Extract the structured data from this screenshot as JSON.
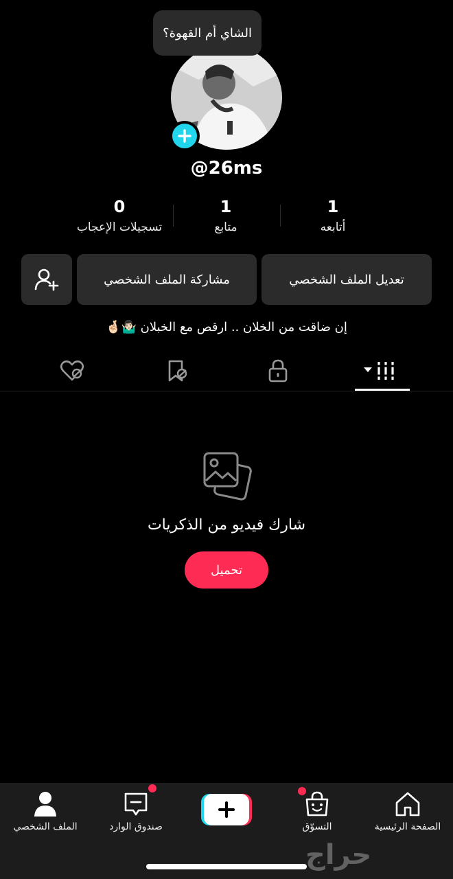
{
  "profile": {
    "bubble_text": "الشاي أم القهوة؟",
    "handle": "@26ms"
  },
  "stats": [
    {
      "value": "0",
      "label": "تسجيلات الإعجاب"
    },
    {
      "value": "1",
      "label": "متابع"
    },
    {
      "value": "1",
      "label": "أتابعه"
    }
  ],
  "actions": {
    "edit_label": "تعديل الملف الشخصي",
    "share_label": "مشاركة الملف الشخصي",
    "add_friend_icon": "add-user-icon"
  },
  "bio": "إن ضاقت من الخلان .. ارقص مع الخبلان 🤷🏻‍♂️🤞🏻",
  "tabs": [
    {
      "icon": "liked-heart-hidden-icon"
    },
    {
      "icon": "bookmark-hidden-icon"
    },
    {
      "icon": "lock-icon"
    },
    {
      "icon": "grid-videos-icon",
      "active": true
    }
  ],
  "empty_state": {
    "icon": "photos-icon",
    "title": "شارك فيديو من الذكريات",
    "button_label": "تحميل"
  },
  "bottom_nav": {
    "profile": "الملف الشخصي",
    "inbox": "صندوق الوارد",
    "create_icon": "create-plus-icon",
    "shop": "التسوّق",
    "home": "الصفحة الرئيسية"
  },
  "watermark": "حراج",
  "colors": {
    "accent_pink": "#fe2c55",
    "accent_cyan": "#20d5ec",
    "background": "#000000",
    "button_bg": "#2b2b2b"
  }
}
